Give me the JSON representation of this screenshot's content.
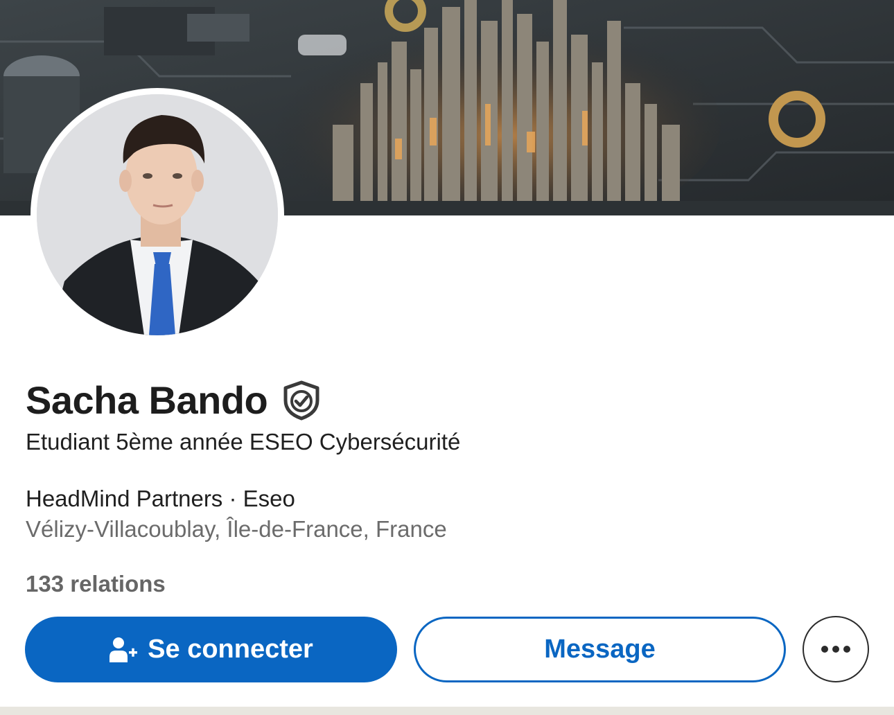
{
  "profile": {
    "name": "Sacha Bando",
    "headline": "Etudiant 5ème année ESEO Cybersécurité",
    "company_line": "HeadMind Partners · Eseo",
    "location": "Vélizy-Villacoublay, Île-de-France, France",
    "relations": "133 relations"
  },
  "actions": {
    "connect_label": "Se connecter",
    "message_label": "Message"
  },
  "icons": {
    "verified": "shield-check-icon",
    "connect": "add-person-icon",
    "more": "ellipsis-icon"
  },
  "colors": {
    "accent": "#0a66c2",
    "text_primary": "#1d1d1d",
    "text_secondary": "#6b6b6b"
  }
}
